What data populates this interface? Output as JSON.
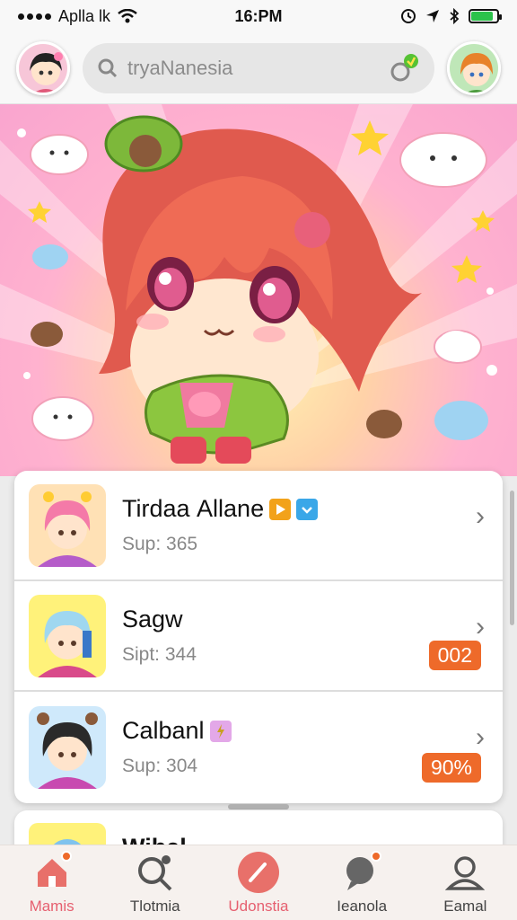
{
  "status_bar": {
    "carrier": "Aplla lk",
    "time": "16:PM",
    "battery_level": 0.85
  },
  "header": {
    "search_placeholder": "tryaNanesia"
  },
  "list": {
    "items": [
      {
        "title": "Tirdaа Allane",
        "subtitle": "Sup: 365",
        "badge": ""
      },
      {
        "title": "Sagw",
        "subtitle": "Sipt: 344",
        "badge": "002"
      },
      {
        "title": "Calbanl",
        "subtitle": "Sup: 304",
        "badge": "90%"
      }
    ],
    "peek_title": "Wibal"
  },
  "nav": {
    "items": [
      {
        "label": "Mamis",
        "icon": "home-icon"
      },
      {
        "label": "Tlotmia",
        "icon": "search-icon"
      },
      {
        "label": "Udonstia",
        "icon": "pencil-icon"
      },
      {
        "label": "Ieanola",
        "icon": "chat-icon"
      },
      {
        "label": "Eamal",
        "icon": "profile-icon"
      }
    ]
  },
  "colors": {
    "accent": "#ee6a2a",
    "nav_active": "#e66070",
    "battery": "#2bc24a"
  }
}
